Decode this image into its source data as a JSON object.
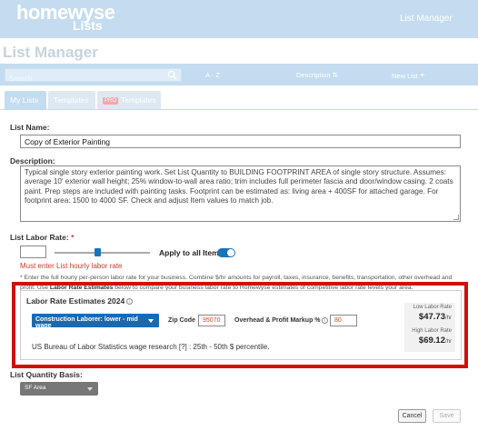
{
  "header": {
    "logo_line1": "homewyse",
    "logo_line2": "Lists",
    "title": "List Manager"
  },
  "page_title": "List Manager",
  "toolbar": {
    "search_placeholder": "Search",
    "sort_az": "A - Z",
    "sort_desc": "Description",
    "new_list": "New List"
  },
  "tabs": [
    {
      "label": "My Lists",
      "active": true
    },
    {
      "label": "Templates",
      "active": false
    },
    {
      "label": "Templates",
      "badge": "PRO",
      "active": false
    }
  ],
  "form": {
    "list_name_label": "List Name:",
    "list_name_value": "Copy of Exterior Painting",
    "description_label": "Description:",
    "description_value": "Typical single story exterior painting work. Set List Quantity to BUILDING FOOTPRINT AREA of single story structure. Assumes: average 10' exterior wall height; 25% window-to-wall area ratio; trim includes full perimeter fascia and door/window casing. 2 coats paint. Prep steps are included with painting tasks. Footprint can be estimated as: living area + 400SF for attached garage. For footprint area: 1500 to 4000 SF. Check and adjust Item values to match job.",
    "labor_rate_label": "List Labor Rate:",
    "labor_rate_required": "*",
    "labor_rate_value": "",
    "apply_all_label": "Apply to all Items",
    "apply_all_on": true,
    "error": "Must enter List hourly labor rate",
    "hint_prefix": "* Enter the full hourly per-person labor rate for your business. Combine $/hr amounts for payroll, taxes, insurance, benefits, transportation, other overhead and profit. Use ",
    "hint_link": "Labor Rate Estimates",
    "hint_suffix": " below to compare your business labor rate to Homewyse estimates of competitive labor rate levels your area."
  },
  "labor_estimates": {
    "title": "Labor Rate Estimates 2024",
    "trade_select": "Construction Laborer: lower - mid wage",
    "zip_label": "Zip Code",
    "zip_value": "95070",
    "markup_label": "Overhead & Profit Markup %",
    "markup_value": "80",
    "low_label": "Low Labor Rate",
    "low_value": "$47.73",
    "high_label": "High Labor Rate",
    "high_value": "$69.12",
    "per_hr": "/hr",
    "bls_text": "US Bureau of Labor Statistics wage research [?] : 25th - 50th $ percentile."
  },
  "quantity": {
    "label": "List Quantity Basis:",
    "value": "SF Area"
  },
  "buttons": {
    "cancel": "Cancel",
    "save": "Save"
  },
  "colors": {
    "header_bg": "#c3dcf0",
    "accent_blue": "#1a69b0",
    "highlight_red": "#d40c0c",
    "error_red": "#d23b2a"
  }
}
